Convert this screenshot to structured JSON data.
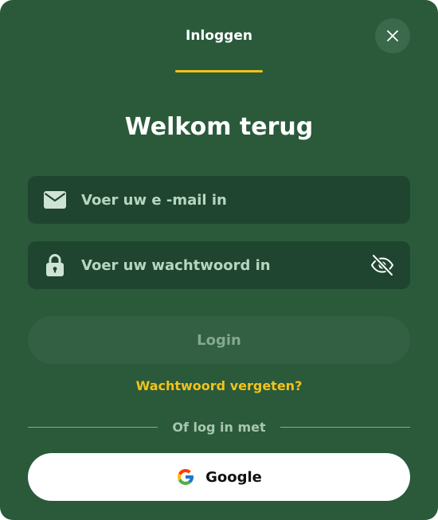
{
  "header": {
    "tab_label": "Inloggen",
    "close_icon": "close-icon"
  },
  "title": "Welkom terug",
  "email_field": {
    "icon": "envelope-icon",
    "placeholder": "Voer uw e -mail in",
    "value": ""
  },
  "password_field": {
    "icon": "lock-icon",
    "placeholder": "Voer uw wachtwoord in",
    "value": "",
    "toggle_icon": "eye-off-icon"
  },
  "login_button": {
    "label": "Login"
  },
  "forgot_link": {
    "label": "Wachtwoord vergeten?"
  },
  "divider": {
    "label": "Of log in met"
  },
  "google_button": {
    "label": "Google",
    "icon": "google-icon"
  },
  "colors": {
    "background": "#2a5a3a",
    "field": "#1f4530",
    "accent": "#f2c21b",
    "login_button": "#335f42",
    "google_button": "#ffffff"
  }
}
